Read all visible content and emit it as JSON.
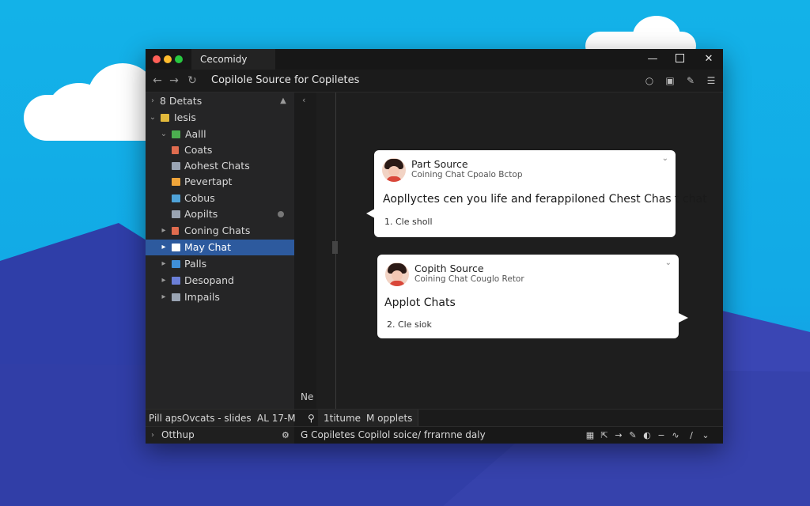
{
  "window": {
    "tab_title": "Cecomidy",
    "nav_title": "Copilole Source for Copiletes"
  },
  "sidebar": {
    "header_label": "8 Detats",
    "items": [
      {
        "label": "Iesis",
        "icon_color": "#e2b93b"
      },
      {
        "label": "Aalll",
        "icon_color": "#4caf50"
      },
      {
        "label": "Coats",
        "icon_color": "#e06c4f"
      },
      {
        "label": "Aohest Chats",
        "icon_color": "#9aa4b3"
      },
      {
        "label": "Pevertapt",
        "icon_color": "#f0a53a"
      },
      {
        "label": "Cobus",
        "icon_color": "#4fa3d9"
      },
      {
        "label": "Aopilts",
        "icon_color": "#9aa4b3"
      },
      {
        "label": "Coning Chats",
        "icon_color": "#e06c4f"
      },
      {
        "label": "May Chat",
        "icon_color": "#ffffff"
      },
      {
        "label": "Palls",
        "icon_color": "#3f8fd8"
      },
      {
        "label": "Desopand",
        "icon_color": "#6b7fd8"
      },
      {
        "label": "Impails",
        "icon_color": "#9aa4b3"
      }
    ]
  },
  "editor": {
    "ne_label": "Ne",
    "cards": [
      {
        "name": "Part Source",
        "subtitle": "Coining Chat Cpoalo Bctop",
        "body": "Aopllyctes cen you life and ferappiloned Chest Chas t chat",
        "footer": "1. Cle sholl"
      },
      {
        "name": "Copith Source",
        "subtitle": "Coining Chat Couglo Retor",
        "body": "Applot Chats",
        "footer": "2. Cle siok"
      }
    ]
  },
  "panels": {
    "left_text": "Pill apsOvcats - slides",
    "left_time": "AL 17-M",
    "tabs": [
      "1titume",
      "M opplets"
    ]
  },
  "statusbar": {
    "left_label": "Otthup",
    "main_text": "G Copiletes Copilol soice/ frrarnne daly"
  },
  "colors": {
    "accent_selection": "#2d5a9e",
    "window_bg": "#1e1e1e",
    "sidebar_bg": "#252526"
  }
}
